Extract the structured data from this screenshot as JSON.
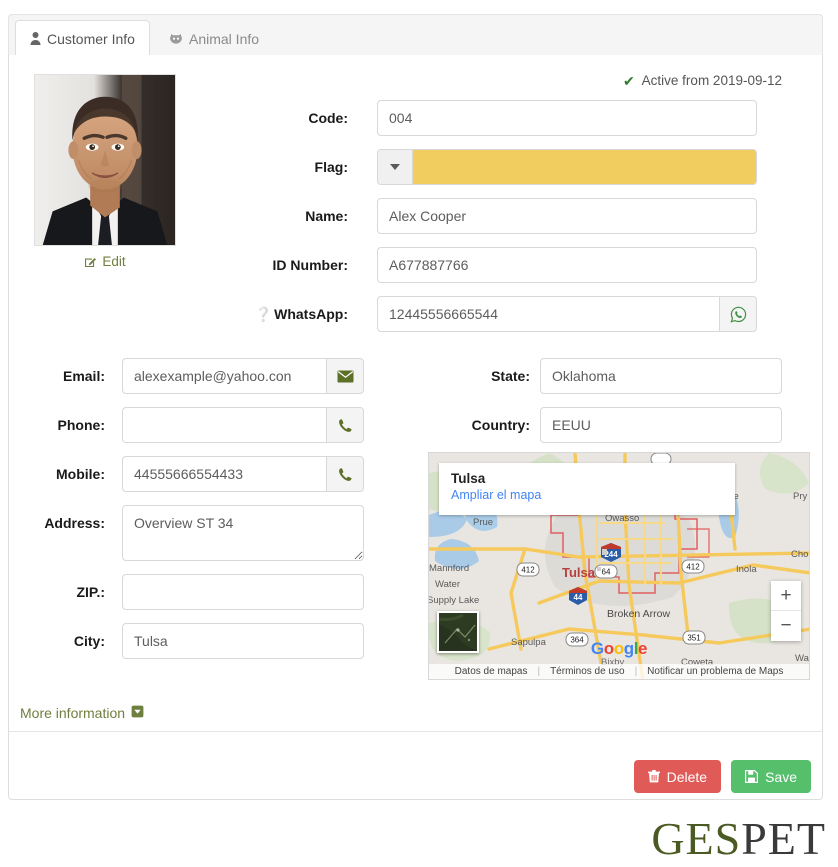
{
  "tabs": [
    {
      "label": "Customer Info",
      "icon": "person-icon",
      "active": true
    },
    {
      "label": "Animal Info",
      "icon": "animal-paw-icon",
      "active": false
    }
  ],
  "status": {
    "icon": "check-icon",
    "text": "Active from 2019-09-12",
    "color": "#2d7a2d"
  },
  "photo": {
    "edit_label": "Edit",
    "edit_icon": "edit-pencil-icon",
    "alt": "customer-portrait"
  },
  "top_form": {
    "code": {
      "label": "Code:",
      "value": "004"
    },
    "flag": {
      "label": "Flag:",
      "value": "",
      "color": "#f0cd5e",
      "caret_icon": "caret-down-icon"
    },
    "name": {
      "label": "Name:",
      "value": "Alex Cooper"
    },
    "id_number": {
      "label": "ID Number:",
      "value": "A677887766"
    },
    "whatsapp": {
      "label": "WhatsApp:",
      "help_icon": "question-circle-icon",
      "value": "12445556665544",
      "addon_icon": "whatsapp-icon"
    }
  },
  "left_column": {
    "email": {
      "label": "Email:",
      "value": "alexexample@yahoo.con",
      "addon_icon": "envelope-icon"
    },
    "phone": {
      "label": "Phone:",
      "value": "",
      "addon_icon": "phone-icon"
    },
    "mobile": {
      "label": "Mobile:",
      "value": "44555666554433",
      "addon_icon": "phone-icon"
    },
    "address": {
      "label": "Address:",
      "value": "Overview ST 34"
    },
    "zip": {
      "label": "ZIP.:",
      "value": ""
    },
    "city": {
      "label": "City:",
      "value": "Tulsa"
    }
  },
  "right_column": {
    "state": {
      "label": "State:",
      "value": "Oklahoma"
    },
    "country": {
      "label": "Country:",
      "value": "EEUU"
    }
  },
  "map": {
    "info_title": "Tulsa",
    "info_link": "Ampliar el mapa",
    "zoom_in": "+",
    "zoom_out": "−",
    "logo": "Google",
    "attribution": [
      "Datos de mapas",
      "Términos de uso",
      "Notificar un problema de Maps"
    ],
    "labels": [
      "Owasso",
      "Prue",
      "Mannford",
      "Water",
      "Supply Lake",
      "Tulsa",
      "Inola",
      "Broken Arrow",
      "Sapulpa",
      "Bixby",
      "Coweta",
      "Cho",
      "Pry",
      "ore",
      "Wago"
    ],
    "route_shields": [
      "412",
      "244",
      "64",
      "44",
      "412",
      "364",
      "351"
    ]
  },
  "more_information": {
    "label": "More information",
    "icon": "caret-down-box-icon"
  },
  "actions": {
    "delete": {
      "label": "Delete",
      "icon": "trash-icon",
      "color": "#e05b58"
    },
    "save": {
      "label": "Save",
      "icon": "floppy-disk-icon",
      "color": "#56bf6b"
    }
  },
  "brand": {
    "part1": "GES",
    "part2": "PET",
    "part1_color": "#4a5a22",
    "part2_color": "#3a3a3a"
  }
}
